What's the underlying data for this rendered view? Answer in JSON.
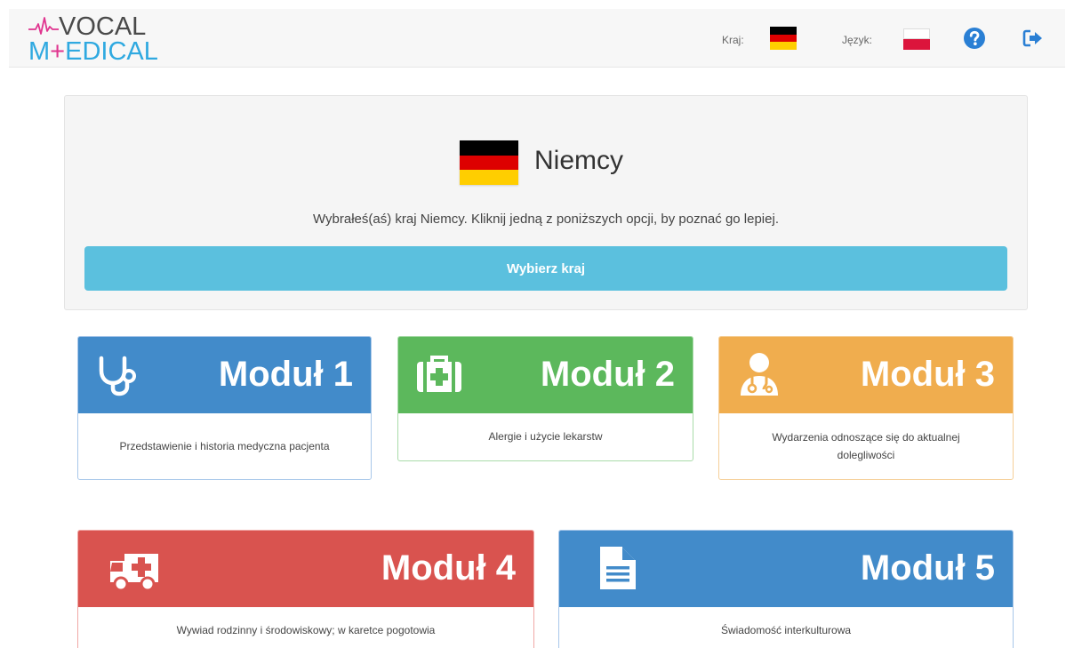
{
  "logo": {
    "line1": "VOCAL",
    "line2_start": "M",
    "line2_plus": "+",
    "line2_end": "EDICAL"
  },
  "header": {
    "country_label": "Kraj:",
    "language_label": "Język:",
    "icons": {
      "help": "question-circle-icon",
      "logout": "sign-out-icon"
    }
  },
  "country": {
    "name": "Niemcy",
    "description": "Wybrałeś(aś) kraj Niemcy. Kliknij jedną z poniższych opcji, by poznać go lepiej.",
    "choose_button": "Wybierz kraj",
    "flag_colors": [
      "#000000",
      "#dd0000",
      "#ffce00"
    ]
  },
  "language": {
    "flag_colors": [
      "#ffffff",
      "#dc143c"
    ]
  },
  "modules": [
    {
      "title": "Moduł 1",
      "description": "Przedstawienie i historia medyczna pacjenta",
      "icon": "stethoscope-icon",
      "color": "#428bca"
    },
    {
      "title": "Moduł 2",
      "description": "Alergie i użycie lekarstw",
      "icon": "medkit-icon",
      "color": "#5cb85c"
    },
    {
      "title": "Moduł 3",
      "description": "Wydarzenia odnoszące się do aktualnej dolegliwości",
      "icon": "user-doctor-icon",
      "color": "#f0ad4e"
    },
    {
      "title": "Moduł 4",
      "description": "Wywiad rodzinny i środowiskowy; w karetce pogotowia",
      "icon": "ambulance-icon",
      "color": "#d9534f"
    },
    {
      "title": "Moduł 5",
      "description": "Świadomość interkulturowa",
      "icon": "file-text-icon",
      "color": "#428bca"
    }
  ]
}
